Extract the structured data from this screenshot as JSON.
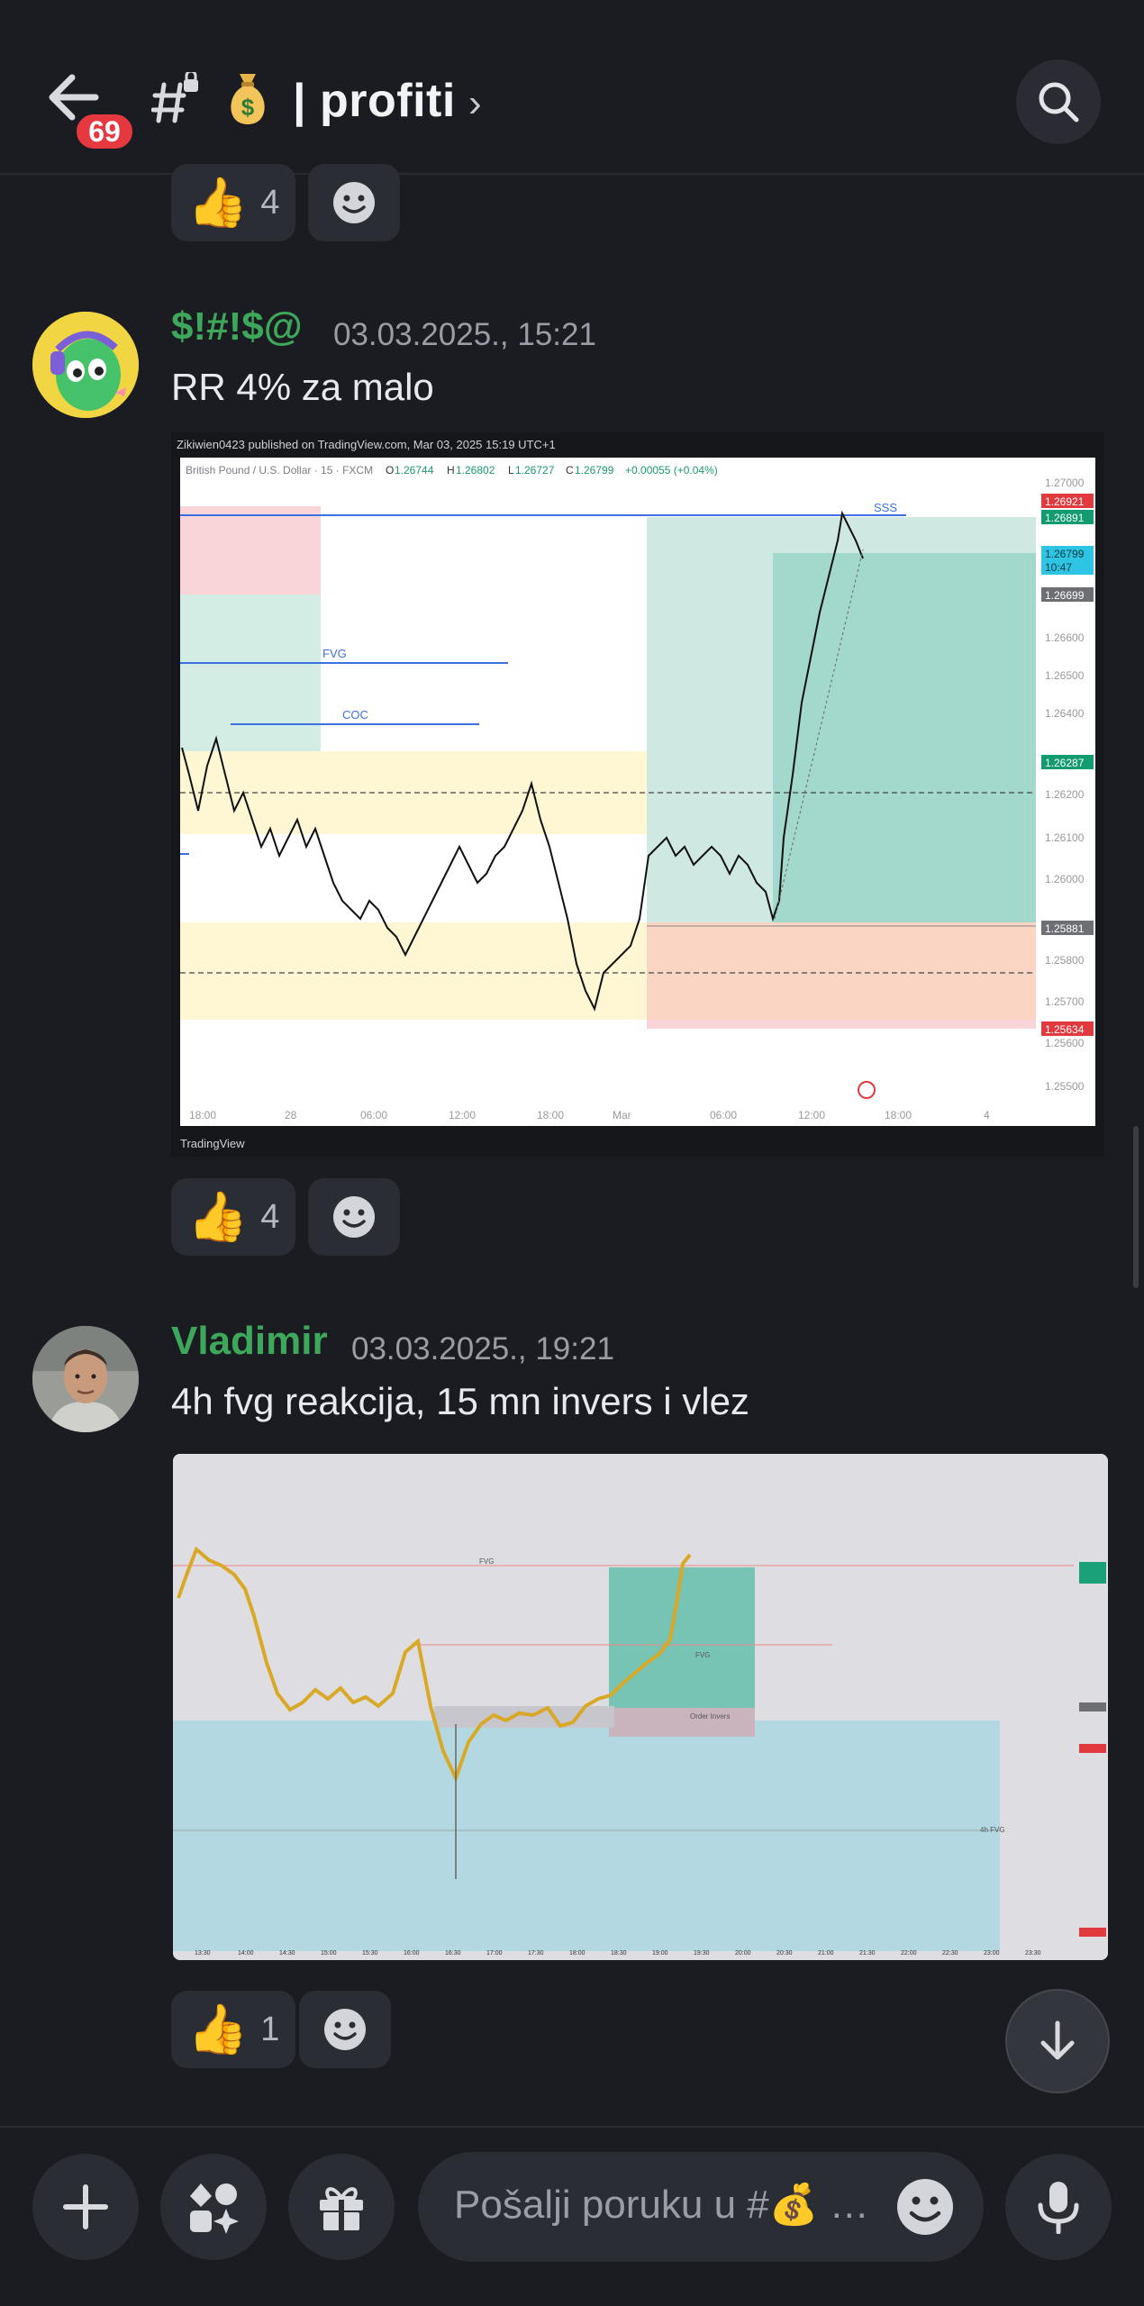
{
  "header": {
    "badge_count": "69",
    "channel_title": "| profiti",
    "chevron": "›",
    "channel_emoji": "money-bag"
  },
  "top_reactions": {
    "emoji": "👍",
    "count": "4"
  },
  "messages": [
    {
      "author": "$!#!$@",
      "timestamp": "03.03.2025., 15:21",
      "text": "RR 4% za malo",
      "author_color": "#3da85a",
      "reaction": {
        "emoji": "👍",
        "count": "4"
      },
      "chart": {
        "header_line": "Zikiwien0423 published on TradingView.com, Mar 03, 2025 15:19 UTC+1",
        "symbol_line": "British Pound / U.S. Dollar · 15 · FXCM",
        "ohlc": {
          "o_label": "O",
          "o": "1.26744",
          "h_label": "H",
          "h": "1.26802",
          "l_label": "L",
          "l": "1.26727",
          "c_label": "C",
          "c": "1.26799",
          "change": "+0.00055 (+0.04%)"
        },
        "labels": {
          "sss": "SSS",
          "fvg": "FVG",
          "coc": "COC"
        },
        "price_ticks": [
          "1.27000",
          "1.26600",
          "1.26500",
          "1.26400",
          "1.26200",
          "1.26100",
          "1.26000",
          "1.25800",
          "1.25700",
          "1.25600",
          "1.25500"
        ],
        "price_badges": [
          {
            "text": "1.26921",
            "color": "#e03a3e"
          },
          {
            "text": "1.26891",
            "color": "#139b70"
          },
          {
            "text": "1.26799",
            "color": "#2ec4e3"
          },
          {
            "text": "10:47",
            "color": "#2ec4e3"
          },
          {
            "text": "1.26699",
            "color": "#6d6f75"
          },
          {
            "text": "1.26287",
            "color": "#139b70"
          },
          {
            "text": "1.25881",
            "color": "#6d6f75"
          },
          {
            "text": "1.25634",
            "color": "#e03a3e"
          }
        ],
        "time_ticks": [
          "18:00",
          "28",
          "06:00",
          "12:00",
          "18:00",
          "Mar",
          "06:00",
          "12:00",
          "18:00",
          "4"
        ],
        "footer": "TradingView"
      }
    },
    {
      "author": "Vladimir",
      "timestamp": "03.03.2025., 19:21",
      "text": "4h fvg reakcija, 15 mn invers i vlez",
      "author_color": "#3da85a",
      "reaction": {
        "emoji": "👍",
        "count": "1"
      },
      "chart": {
        "labels": {
          "fvg": "FVG",
          "fvg2": "4h FVG",
          "order_invers": "Order Invers"
        },
        "time_ticks": [
          "13:30",
          "14:00",
          "14:30",
          "15:00",
          "15:30",
          "16:00",
          "16:30",
          "17:00",
          "17:30",
          "18:00",
          "18:30",
          "19:00",
          "19:30",
          "20:00",
          "20:30",
          "21:00",
          "21:30",
          "22:00",
          "22:30",
          "23:00",
          "23:30"
        ]
      }
    }
  ],
  "composer": {
    "placeholder": "Pošalji poruku u #💰 …"
  },
  "colors": {
    "background": "#1b1c22",
    "pill": "#2b2d35",
    "author_green": "#3da85a",
    "badge_red": "#e5383f"
  }
}
